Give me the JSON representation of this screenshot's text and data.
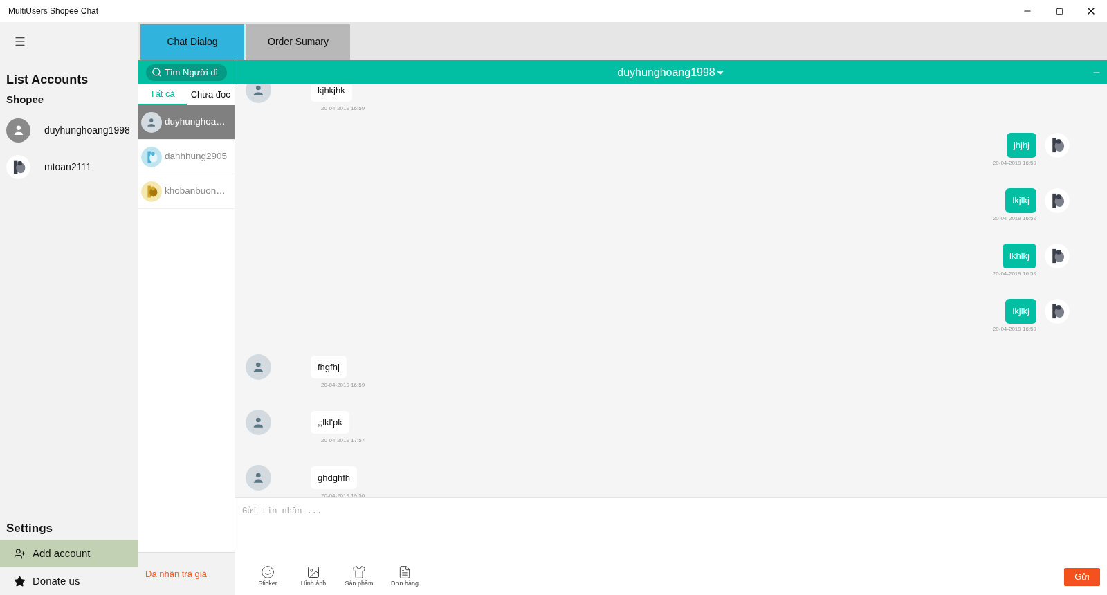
{
  "window": {
    "title": "MultiUsers Shopee Chat"
  },
  "sidebar": {
    "heading": "List Accounts",
    "subheading": "Shopee",
    "accounts": [
      {
        "name": "duyhunghoang1998",
        "kind": "default"
      },
      {
        "name": "mtoan2111",
        "kind": "picture"
      }
    ],
    "settings_heading": "Settings",
    "settings_items": [
      {
        "label": "Add account",
        "selected": true
      },
      {
        "label": "Donate us",
        "selected": false
      }
    ]
  },
  "tabs": [
    {
      "label": "Chat Dialog",
      "selected": true
    },
    {
      "label": "Order Sumary",
      "selected": false
    }
  ],
  "contacts": {
    "search": {
      "placeholder": "Tìm Người dì"
    },
    "filters": [
      {
        "label": "Tất cả",
        "selected": true
      },
      {
        "label": "Chưa đọc",
        "selected": false
      }
    ],
    "items": [
      {
        "name": "duyhunghoa…",
        "kind": "default",
        "selected": true
      },
      {
        "name": "danhhung2905",
        "kind": "picture",
        "selected": false
      },
      {
        "name": "khobanbuon…",
        "kind": "picture",
        "selected": false
      }
    ],
    "footer": "Đã nhận trả giá"
  },
  "chat": {
    "title": "duyhunghoang1998",
    "messages": [
      {
        "kind": "received",
        "text": "kjhkjhk",
        "time": "20-04-2019 16:59"
      },
      {
        "kind": "sent",
        "text": "jhjhj",
        "time": "20-04-2019 16:59"
      },
      {
        "kind": "sent",
        "text": "lkjlkj",
        "time": "20-04-2019 16:59"
      },
      {
        "kind": "sent",
        "text": "lkhlkj",
        "time": "20-04-2019 16:59"
      },
      {
        "kind": "sent",
        "text": "lkjlkj",
        "time": "20-04-2019 16:59"
      },
      {
        "kind": "received",
        "text": "fhgfhj",
        "time": "20-04-2019 16:59"
      },
      {
        "kind": "received",
        "text": ",;lkl'pk",
        "time": "20-04-2019 17:57"
      },
      {
        "kind": "received",
        "text": "ghdghfh",
        "time": "20-04-2019 19:50"
      }
    ],
    "composer": {
      "placeholder": "Gửi tin nhắn ..."
    },
    "tools": [
      {
        "label": "Sticker"
      },
      {
        "label": "Hình ảnh"
      },
      {
        "label": "Sản phẩm"
      },
      {
        "label": "Đơn hàng"
      }
    ],
    "send": "Gửi"
  }
}
